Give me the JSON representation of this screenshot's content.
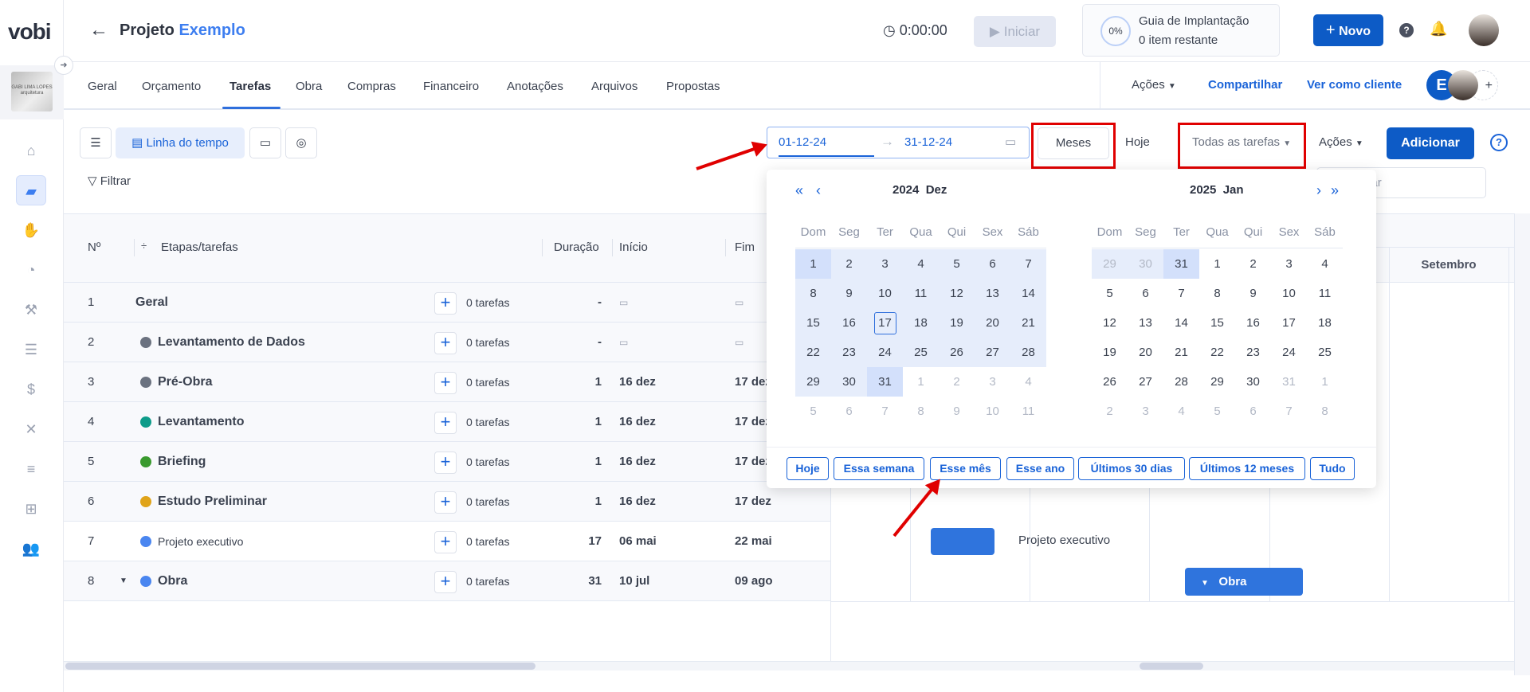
{
  "app": {
    "logo": "vobi",
    "org_logo_text": "GABI LIMA LOPES arquitetura"
  },
  "header": {
    "title_part1": "Projeto",
    "title_part2": "Exemplo",
    "timer": "0:00:00",
    "start_label": "Iniciar",
    "guide": {
      "percent": "0%",
      "title": "Guia de Implantação",
      "subtitle": "0 item restante"
    },
    "new_label": "Novo"
  },
  "tabs": [
    {
      "label": "Geral"
    },
    {
      "label": "Orçamento"
    },
    {
      "label": "Tarefas",
      "active": true
    },
    {
      "label": "Obra"
    },
    {
      "label": "Compras"
    },
    {
      "label": "Financeiro"
    },
    {
      "label": "Anotações"
    },
    {
      "label": "Arquivos"
    },
    {
      "label": "Propostas"
    }
  ],
  "subheader": {
    "actions_label": "Ações",
    "share_label": "Compartilhar",
    "client_view_label": "Ver como cliente",
    "avatar_initial": "E",
    "add_member": "+"
  },
  "toolbar": {
    "timeline_label": "Linha do tempo",
    "filter_label": "Filtrar",
    "date_start": "01-12-24",
    "date_end": "31-12-24",
    "scale_label": "Meses",
    "today_label": "Hoje",
    "task_filter_label": "Todas as tarefas",
    "actions_label": "Ações",
    "add_label": "Adicionar",
    "search_placeholder": "Pesquisar"
  },
  "calendar": {
    "left": {
      "year": "2024",
      "month": "Dez"
    },
    "right": {
      "year": "2025",
      "month": "Jan"
    },
    "weekdays": [
      "Dom",
      "Seg",
      "Ter",
      "Qua",
      "Qui",
      "Sex",
      "Sáb"
    ],
    "left_days": [
      "1",
      "2",
      "3",
      "4",
      "5",
      "6",
      "7",
      "8",
      "9",
      "10",
      "11",
      "12",
      "13",
      "14",
      "15",
      "16",
      "17",
      "18",
      "19",
      "20",
      "21",
      "22",
      "23",
      "24",
      "25",
      "26",
      "27",
      "28",
      "29",
      "30",
      "31",
      "1",
      "2",
      "3",
      "4",
      "5",
      "6",
      "7",
      "8",
      "9",
      "10",
      "11"
    ],
    "right_days": [
      "29",
      "30",
      "31",
      "1",
      "2",
      "3",
      "4",
      "5",
      "6",
      "7",
      "8",
      "9",
      "10",
      "11",
      "12",
      "13",
      "14",
      "15",
      "16",
      "17",
      "18",
      "19",
      "20",
      "21",
      "22",
      "23",
      "24",
      "25",
      "26",
      "27",
      "28",
      "29",
      "30",
      "31",
      "1",
      "2",
      "3",
      "4",
      "5",
      "6",
      "7",
      "8"
    ],
    "today": "17",
    "quick_ranges": [
      "Hoje",
      "Essa semana",
      "Esse mês",
      "Esse ano",
      "Últimos 30 dias",
      "Últimos 12 meses",
      "Tudo"
    ]
  },
  "table": {
    "headers": {
      "number": "Nº",
      "name": "Etapas/tarefas",
      "duration": "Duração",
      "start": "Início",
      "end": "Fim"
    },
    "rows": [
      {
        "n": "1",
        "name": "Geral",
        "tasks": "0 tarefas",
        "duration": "-",
        "start": "",
        "end": "",
        "color": "",
        "level": 0
      },
      {
        "n": "2",
        "name": "Levantamento de Dados",
        "tasks": "0 tarefas",
        "duration": "-",
        "start": "",
        "end": "",
        "color": "#6b7280",
        "level": 1
      },
      {
        "n": "3",
        "name": "Pré-Obra",
        "tasks": "0 tarefas",
        "duration": "1",
        "start": "16 dez",
        "end": "17 dez",
        "color": "#6b7280",
        "level": 1
      },
      {
        "n": "4",
        "name": "Levantamento",
        "tasks": "0 tarefas",
        "duration": "1",
        "start": "16 dez",
        "end": "17 dez",
        "color": "#0e9c8a",
        "level": 1
      },
      {
        "n": "5",
        "name": "Briefing",
        "tasks": "0 tarefas",
        "duration": "1",
        "start": "16 dez",
        "end": "17 dez",
        "color": "#3a9a2f",
        "level": 1
      },
      {
        "n": "6",
        "name": "Estudo Preliminar",
        "tasks": "0 tarefas",
        "duration": "1",
        "start": "16 dez",
        "end": "17 dez",
        "color": "#e0a41a",
        "level": 1
      },
      {
        "n": "7",
        "name": "Projeto executivo",
        "tasks": "0 tarefas",
        "duration": "17",
        "start": "06 mai",
        "end": "22 mai",
        "color": "#4a86f0",
        "level": 2
      },
      {
        "n": "8",
        "name": "Obra",
        "tasks": "0 tarefas",
        "duration": "31",
        "start": "10 jul",
        "end": "09 ago",
        "color": "#4a86f0",
        "level": 1,
        "collapsible": true
      }
    ]
  },
  "gantt": {
    "visible_month": "Setembro",
    "bars": [
      {
        "label": "Projeto executivo"
      },
      {
        "label": "Obra"
      }
    ]
  },
  "colors": {
    "primary": "#0d5bc6",
    "accent": "#3d7ef0",
    "annotation": "#e00000"
  }
}
